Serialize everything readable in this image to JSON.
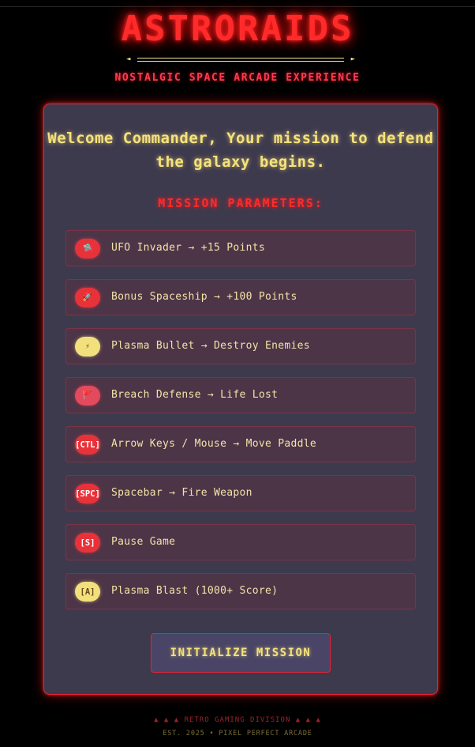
{
  "header": {
    "title": "ASTRORAIDS",
    "subtitle": "NOSTALGIC SPACE ARCADE EXPERIENCE",
    "divider_left": "◄",
    "divider_right": "►"
  },
  "panel": {
    "welcome": "Welcome Commander, Your mission to defend the galaxy begins.",
    "params_heading": "MISSION PARAMETERS:",
    "rows": [
      {
        "icon": "ufo-icon",
        "badge": "🛸",
        "badge_color": "red",
        "label": "UFO Invader → +15 Points"
      },
      {
        "icon": "rocket-icon",
        "badge": "🚀",
        "badge_color": "red",
        "label": "Bonus Spaceship → +100 Points"
      },
      {
        "icon": "lightning-icon",
        "badge": "⚡",
        "badge_color": "yellow",
        "label": "Plasma Bullet → Destroy Enemies"
      },
      {
        "icon": "flag-icon",
        "badge": "🚩",
        "badge_color": "pink",
        "label": "Breach Defense → Life Lost"
      },
      {
        "icon": "ctl-key-icon",
        "badge": "[CTL]",
        "badge_color": "red",
        "label": "Arrow Keys / Mouse → Move Paddle"
      },
      {
        "icon": "spc-key-icon",
        "badge": "[SPC]",
        "badge_color": "red",
        "label": "Spacebar → Fire Weapon"
      },
      {
        "icon": "s-key-icon",
        "badge": "[S]",
        "badge_color": "red",
        "label": "Pause Game"
      },
      {
        "icon": "a-key-icon",
        "badge": "[A]",
        "badge_color": "yellow",
        "label": "Plasma Blast (1000+ Score)"
      }
    ],
    "cta_label": "INITIALIZE MISSION"
  },
  "footer": {
    "line1": "▲ ▲ ▲ RETRO GAMING DIVISION ▲ ▲ ▲",
    "line2": "EST. 2025 • PIXEL PERFECT ARCADE"
  },
  "colors": {
    "background": "#000000",
    "accent_red": "#ff2b2b",
    "accent_yellow": "#f6e27a",
    "panel": "#3e3a4e",
    "row": "#4d3548"
  }
}
